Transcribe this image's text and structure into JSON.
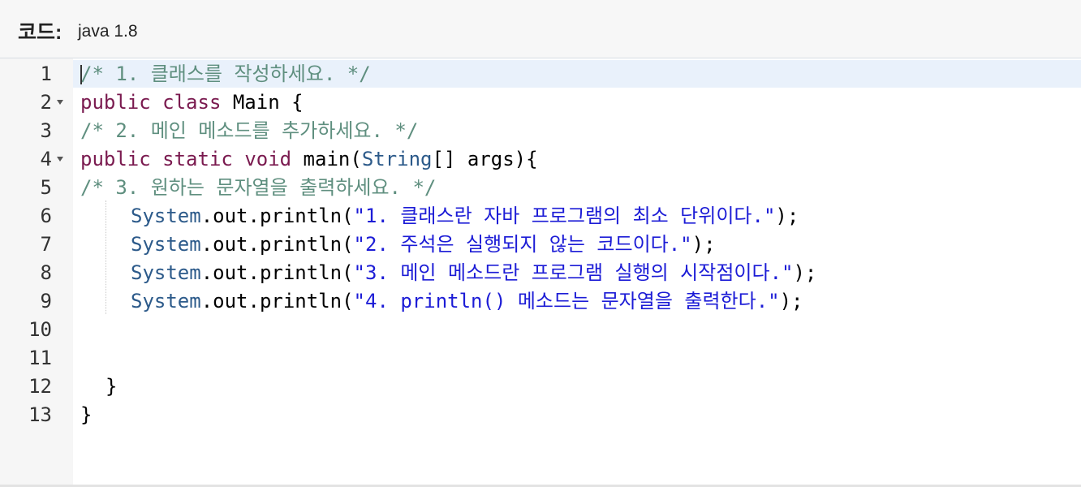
{
  "header": {
    "label": "코드:",
    "language": "java 1.8"
  },
  "editor": {
    "lines": [
      {
        "number": "1",
        "fold": false,
        "tokens": [
          {
            "cls": "cm",
            "text": "/* 1. 클래스를 작성하세요. */"
          }
        ]
      },
      {
        "number": "2",
        "fold": true,
        "tokens": [
          {
            "cls": "kw",
            "text": "public"
          },
          {
            "cls": "pl",
            "text": " "
          },
          {
            "cls": "kw",
            "text": "class"
          },
          {
            "cls": "pl",
            "text": " Main {"
          }
        ]
      },
      {
        "number": "3",
        "fold": false,
        "tokens": [
          {
            "cls": "cm",
            "text": "/* 2. 메인 메소드를 추가하세요. */"
          }
        ]
      },
      {
        "number": "4",
        "fold": true,
        "tokens": [
          {
            "cls": "kw",
            "text": "public"
          },
          {
            "cls": "pl",
            "text": " "
          },
          {
            "cls": "kw",
            "text": "static"
          },
          {
            "cls": "pl",
            "text": " "
          },
          {
            "cls": "kw",
            "text": "void"
          },
          {
            "cls": "pl",
            "text": " main("
          },
          {
            "cls": "ty",
            "text": "String"
          },
          {
            "cls": "pl",
            "text": "[] args){"
          }
        ]
      },
      {
        "number": "5",
        "fold": false,
        "tokens": [
          {
            "cls": "cm",
            "text": "/* 3. 원하는 문자열을 출력하세요. */"
          }
        ]
      },
      {
        "number": "6",
        "fold": false,
        "indent": "indent",
        "tokens": [
          {
            "cls": "ty",
            "text": "System"
          },
          {
            "cls": "pl",
            "text": ".out.println("
          },
          {
            "cls": "st",
            "text": "\"1. 클래스란 자바 프로그램의 최소 단위이다.\""
          },
          {
            "cls": "pl",
            "text": ");"
          }
        ]
      },
      {
        "number": "7",
        "fold": false,
        "indent": "indent",
        "tokens": [
          {
            "cls": "ty",
            "text": "System"
          },
          {
            "cls": "pl",
            "text": ".out.println("
          },
          {
            "cls": "st",
            "text": "\"2. 주석은 실행되지 않는 코드이다.\""
          },
          {
            "cls": "pl",
            "text": ");"
          }
        ]
      },
      {
        "number": "8",
        "fold": false,
        "indent": "indent",
        "tokens": [
          {
            "cls": "ty",
            "text": "System"
          },
          {
            "cls": "pl",
            "text": ".out.println("
          },
          {
            "cls": "st",
            "text": "\"3. 메인 메소드란 프로그램 실행의 시작점이다.\""
          },
          {
            "cls": "pl",
            "text": ");"
          }
        ]
      },
      {
        "number": "9",
        "fold": false,
        "indent": "indent",
        "tokens": [
          {
            "cls": "ty",
            "text": "System"
          },
          {
            "cls": "pl",
            "text": ".out.println("
          },
          {
            "cls": "st",
            "text": "\"4. println() 메소드는 문자열을 출력한다.\""
          },
          {
            "cls": "pl",
            "text": ");"
          }
        ]
      },
      {
        "number": "10",
        "fold": false,
        "tokens": []
      },
      {
        "number": "11",
        "fold": false,
        "tokens": []
      },
      {
        "number": "12",
        "fold": false,
        "indent": "indent-small",
        "tokens": [
          {
            "cls": "pl",
            "text": "}"
          }
        ]
      },
      {
        "number": "13",
        "fold": false,
        "tokens": [
          {
            "cls": "pl",
            "text": "}"
          }
        ]
      }
    ]
  }
}
